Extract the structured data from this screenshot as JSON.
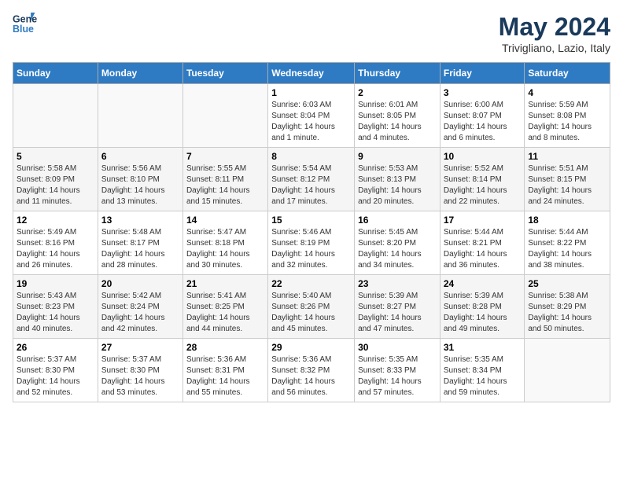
{
  "header": {
    "logo_line1": "General",
    "logo_line2": "Blue",
    "month_title": "May 2024",
    "location": "Trivigliano, Lazio, Italy"
  },
  "days_of_week": [
    "Sunday",
    "Monday",
    "Tuesday",
    "Wednesday",
    "Thursday",
    "Friday",
    "Saturday"
  ],
  "weeks": [
    [
      {
        "day": "",
        "info": ""
      },
      {
        "day": "",
        "info": ""
      },
      {
        "day": "",
        "info": ""
      },
      {
        "day": "1",
        "info": "Sunrise: 6:03 AM\nSunset: 8:04 PM\nDaylight: 14 hours\nand 1 minute."
      },
      {
        "day": "2",
        "info": "Sunrise: 6:01 AM\nSunset: 8:05 PM\nDaylight: 14 hours\nand 4 minutes."
      },
      {
        "day": "3",
        "info": "Sunrise: 6:00 AM\nSunset: 8:07 PM\nDaylight: 14 hours\nand 6 minutes."
      },
      {
        "day": "4",
        "info": "Sunrise: 5:59 AM\nSunset: 8:08 PM\nDaylight: 14 hours\nand 8 minutes."
      }
    ],
    [
      {
        "day": "5",
        "info": "Sunrise: 5:58 AM\nSunset: 8:09 PM\nDaylight: 14 hours\nand 11 minutes."
      },
      {
        "day": "6",
        "info": "Sunrise: 5:56 AM\nSunset: 8:10 PM\nDaylight: 14 hours\nand 13 minutes."
      },
      {
        "day": "7",
        "info": "Sunrise: 5:55 AM\nSunset: 8:11 PM\nDaylight: 14 hours\nand 15 minutes."
      },
      {
        "day": "8",
        "info": "Sunrise: 5:54 AM\nSunset: 8:12 PM\nDaylight: 14 hours\nand 17 minutes."
      },
      {
        "day": "9",
        "info": "Sunrise: 5:53 AM\nSunset: 8:13 PM\nDaylight: 14 hours\nand 20 minutes."
      },
      {
        "day": "10",
        "info": "Sunrise: 5:52 AM\nSunset: 8:14 PM\nDaylight: 14 hours\nand 22 minutes."
      },
      {
        "day": "11",
        "info": "Sunrise: 5:51 AM\nSunset: 8:15 PM\nDaylight: 14 hours\nand 24 minutes."
      }
    ],
    [
      {
        "day": "12",
        "info": "Sunrise: 5:49 AM\nSunset: 8:16 PM\nDaylight: 14 hours\nand 26 minutes."
      },
      {
        "day": "13",
        "info": "Sunrise: 5:48 AM\nSunset: 8:17 PM\nDaylight: 14 hours\nand 28 minutes."
      },
      {
        "day": "14",
        "info": "Sunrise: 5:47 AM\nSunset: 8:18 PM\nDaylight: 14 hours\nand 30 minutes."
      },
      {
        "day": "15",
        "info": "Sunrise: 5:46 AM\nSunset: 8:19 PM\nDaylight: 14 hours\nand 32 minutes."
      },
      {
        "day": "16",
        "info": "Sunrise: 5:45 AM\nSunset: 8:20 PM\nDaylight: 14 hours\nand 34 minutes."
      },
      {
        "day": "17",
        "info": "Sunrise: 5:44 AM\nSunset: 8:21 PM\nDaylight: 14 hours\nand 36 minutes."
      },
      {
        "day": "18",
        "info": "Sunrise: 5:44 AM\nSunset: 8:22 PM\nDaylight: 14 hours\nand 38 minutes."
      }
    ],
    [
      {
        "day": "19",
        "info": "Sunrise: 5:43 AM\nSunset: 8:23 PM\nDaylight: 14 hours\nand 40 minutes."
      },
      {
        "day": "20",
        "info": "Sunrise: 5:42 AM\nSunset: 8:24 PM\nDaylight: 14 hours\nand 42 minutes."
      },
      {
        "day": "21",
        "info": "Sunrise: 5:41 AM\nSunset: 8:25 PM\nDaylight: 14 hours\nand 44 minutes."
      },
      {
        "day": "22",
        "info": "Sunrise: 5:40 AM\nSunset: 8:26 PM\nDaylight: 14 hours\nand 45 minutes."
      },
      {
        "day": "23",
        "info": "Sunrise: 5:39 AM\nSunset: 8:27 PM\nDaylight: 14 hours\nand 47 minutes."
      },
      {
        "day": "24",
        "info": "Sunrise: 5:39 AM\nSunset: 8:28 PM\nDaylight: 14 hours\nand 49 minutes."
      },
      {
        "day": "25",
        "info": "Sunrise: 5:38 AM\nSunset: 8:29 PM\nDaylight: 14 hours\nand 50 minutes."
      }
    ],
    [
      {
        "day": "26",
        "info": "Sunrise: 5:37 AM\nSunset: 8:30 PM\nDaylight: 14 hours\nand 52 minutes."
      },
      {
        "day": "27",
        "info": "Sunrise: 5:37 AM\nSunset: 8:30 PM\nDaylight: 14 hours\nand 53 minutes."
      },
      {
        "day": "28",
        "info": "Sunrise: 5:36 AM\nSunset: 8:31 PM\nDaylight: 14 hours\nand 55 minutes."
      },
      {
        "day": "29",
        "info": "Sunrise: 5:36 AM\nSunset: 8:32 PM\nDaylight: 14 hours\nand 56 minutes."
      },
      {
        "day": "30",
        "info": "Sunrise: 5:35 AM\nSunset: 8:33 PM\nDaylight: 14 hours\nand 57 minutes."
      },
      {
        "day": "31",
        "info": "Sunrise: 5:35 AM\nSunset: 8:34 PM\nDaylight: 14 hours\nand 59 minutes."
      },
      {
        "day": "",
        "info": ""
      }
    ]
  ]
}
